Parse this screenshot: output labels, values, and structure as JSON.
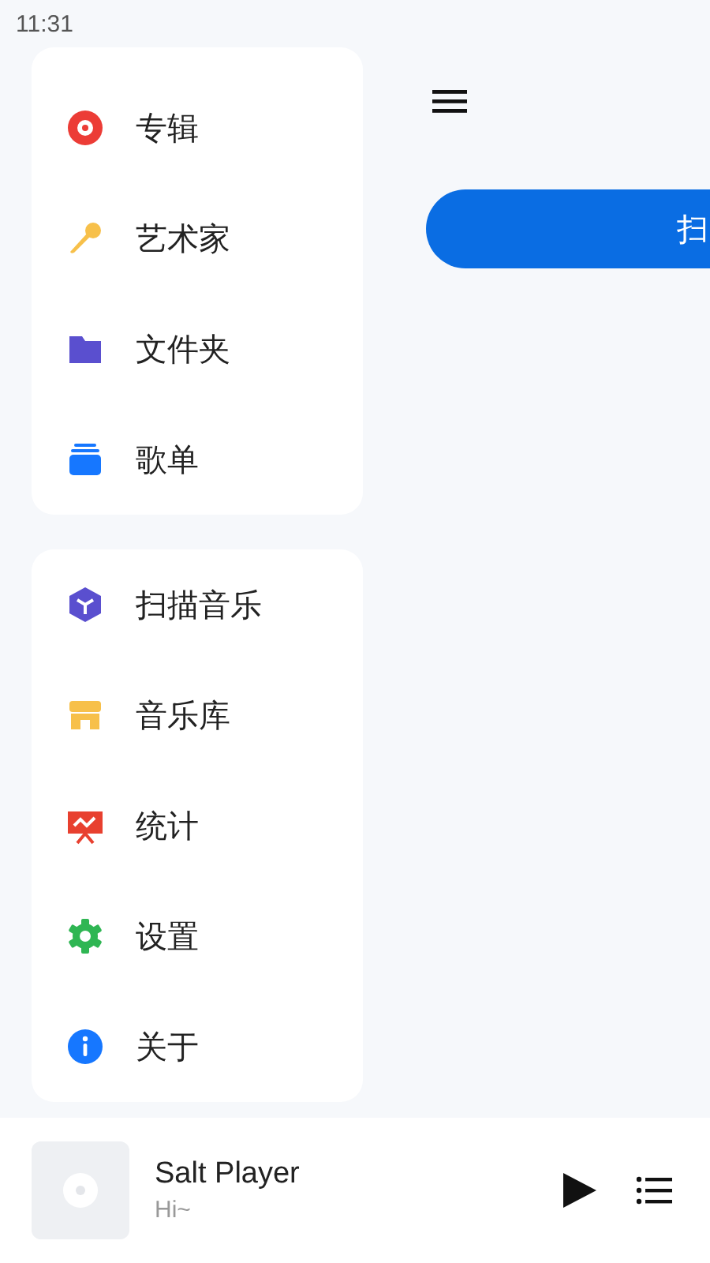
{
  "status_bar": {
    "time": "11:31"
  },
  "drawer": {
    "groups": [
      {
        "items": [
          {
            "label": "专辑",
            "kind": "disc"
          },
          {
            "label": "艺术家",
            "kind": "mic"
          },
          {
            "label": "文件夹",
            "kind": "folder"
          },
          {
            "label": "歌单",
            "kind": "stack"
          }
        ]
      },
      {
        "items": [
          {
            "label": "扫描音乐",
            "kind": "scan"
          },
          {
            "label": "音乐库",
            "kind": "store"
          },
          {
            "label": "统计",
            "kind": "chart"
          },
          {
            "label": "设置",
            "kind": "gear"
          },
          {
            "label": "关于",
            "kind": "info"
          }
        ]
      }
    ]
  },
  "main": {
    "scan_button": {
      "label": "扫"
    }
  },
  "now_playing": {
    "title": "Salt Player",
    "subtitle": "Hi~"
  }
}
